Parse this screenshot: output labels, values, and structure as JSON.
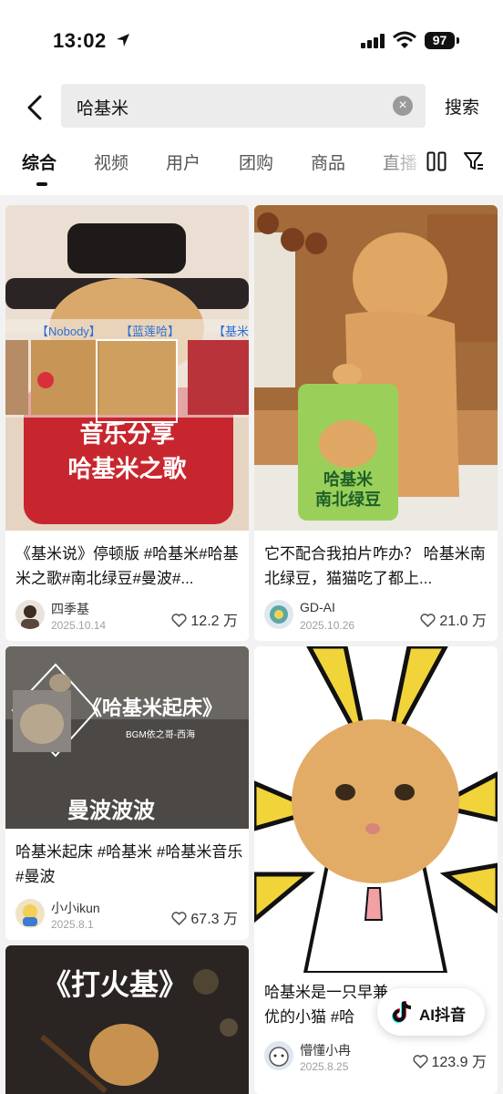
{
  "status_bar": {
    "time": "13:02",
    "battery": "97"
  },
  "search": {
    "query": "哈基米",
    "submit_label": "搜索"
  },
  "tabs": [
    "综合",
    "视频",
    "用户",
    "团购",
    "商品",
    "直播"
  ],
  "cards": [
    {
      "thumb_text": [
        "音乐分享",
        "哈基米之歌"
      ],
      "thumb_captions": [
        "【Nobody】",
        "【蓝莲哈】",
        "【基米"
      ],
      "title": "《基米说》停顿版 #哈基米#哈基米之歌#南北绿豆#曼波#...",
      "author": "四季基",
      "date": "2025.10.14",
      "likes": "12.2 万"
    },
    {
      "thumb_text": [
        "哈基米",
        "南北绿豆"
      ],
      "title": "它不配合我拍片咋办？ 哈基米南北绿豆，猫猫吃了都上...",
      "author": "GD-AI",
      "date": "2025.10.26",
      "likes": "21.0 万"
    },
    {
      "thumb_text": [
        "《哈基米起床》",
        "BGM依之哥-西海",
        "曼波波波"
      ],
      "title": "哈基米起床 #哈基米 #哈基米音乐 #曼波",
      "author": "小小ikun",
      "date": "2025.8.1",
      "likes": "67.3 万"
    },
    {
      "title": "哈基米是一只早兼优的小猫 #哈",
      "author": "懵懂小冉",
      "date": "2025.8.25",
      "likes": "123.9 万"
    },
    {
      "thumb_text": [
        "《打火基》"
      ]
    }
  ],
  "ai_button": {
    "label": "AI抖音"
  },
  "colors": {
    "accent_red": "#c8262e",
    "yellow": "#f0d43a"
  }
}
